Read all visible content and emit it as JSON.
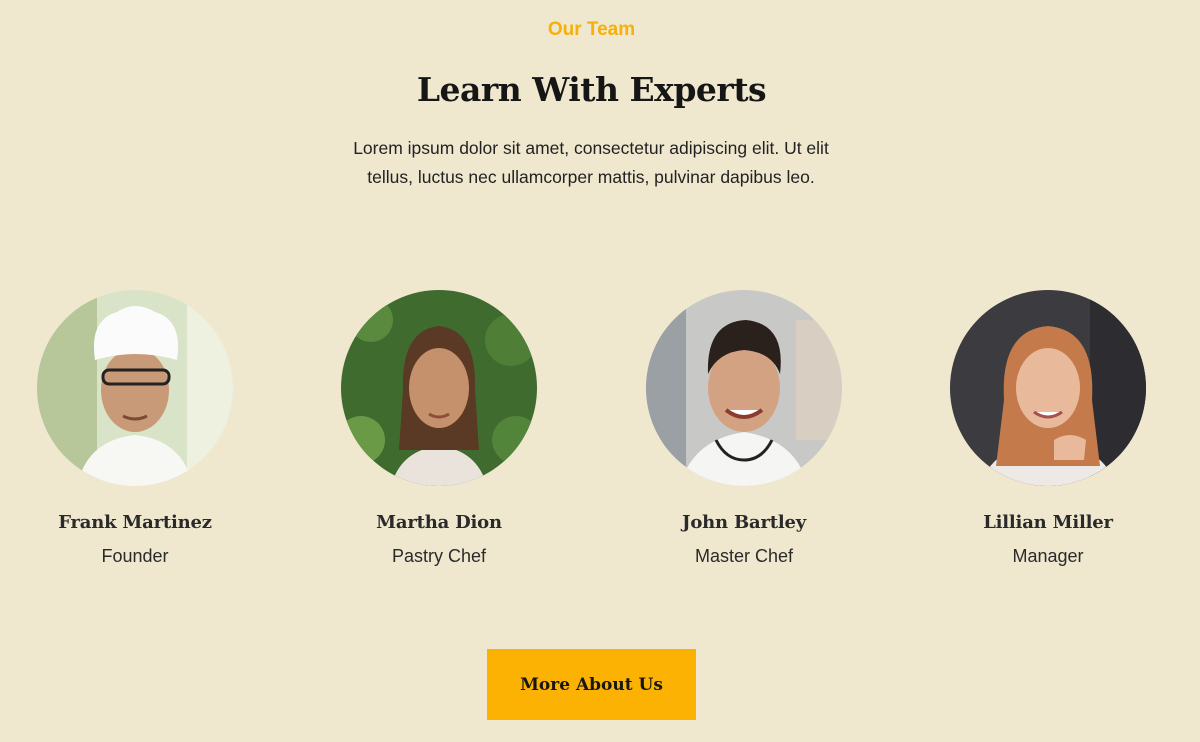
{
  "section": {
    "eyebrow": "Our Team",
    "title": "Learn With Experts",
    "intro": "Lorem ipsum dolor sit amet, consectetur adipiscing elit. Ut elit tellus, luctus nec ullamcorper mattis, pulvinar dapibus leo."
  },
  "team": [
    {
      "name": "Frank Martinez",
      "role": "Founder"
    },
    {
      "name": "Martha Dion",
      "role": "Pastry Chef"
    },
    {
      "name": "John Bartley",
      "role": "Master Chef"
    },
    {
      "name": "Lillian Miller",
      "role": "Manager"
    }
  ],
  "cta": {
    "label": "More About Us"
  },
  "colors": {
    "background": "#efe8cf",
    "accent": "#f5b00a",
    "button": "#fbb203"
  }
}
